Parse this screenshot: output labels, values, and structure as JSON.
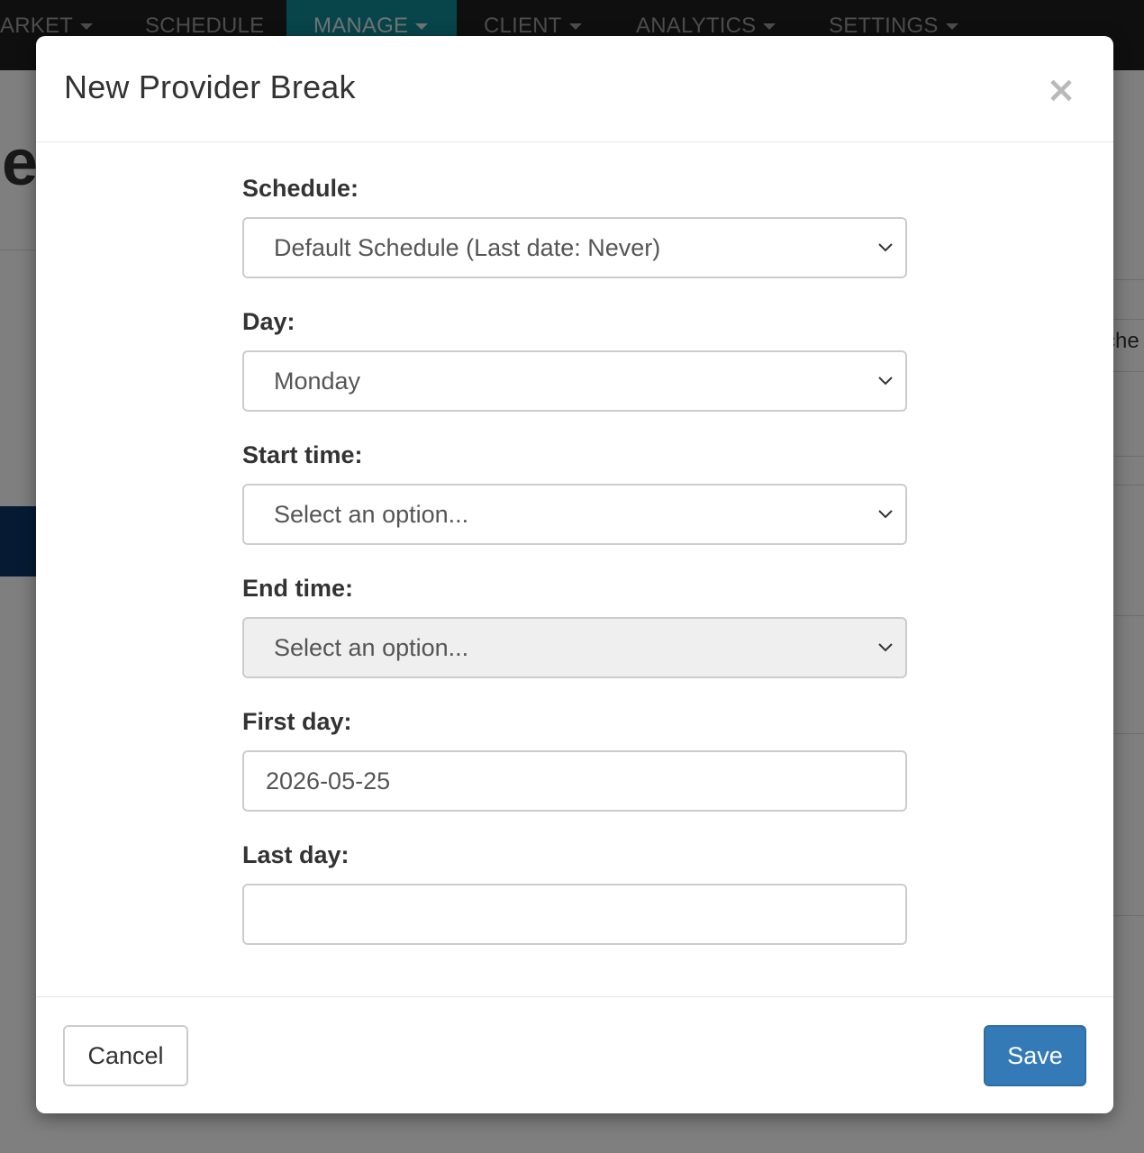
{
  "nav": {
    "items": [
      {
        "label": "ARKET"
      },
      {
        "label": "SCHEDULE"
      },
      {
        "label": "MANAGE"
      },
      {
        "label": "CLIENT"
      },
      {
        "label": "ANALYTICS"
      },
      {
        "label": "SETTINGS"
      }
    ],
    "active_color": "#0e8a96"
  },
  "background": {
    "heading_fragment": "le",
    "right_text_fragment": "che"
  },
  "modal": {
    "title": "New Provider Break",
    "close_symbol": "×",
    "fields": {
      "schedule": {
        "label": "Schedule:",
        "value": "Default Schedule (Last date: Never)"
      },
      "day": {
        "label": "Day:",
        "value": "Monday"
      },
      "start_time": {
        "label": "Start time:",
        "value": "Select an option..."
      },
      "end_time": {
        "label": "End time:",
        "value": "Select an option...",
        "disabled": true
      },
      "first_day": {
        "label": "First day:",
        "value": "2026-05-25"
      },
      "last_day": {
        "label": "Last day:",
        "value": ""
      }
    },
    "footer": {
      "cancel_label": "Cancel",
      "save_label": "Save"
    }
  },
  "colors": {
    "primary": "#337ab7",
    "nav_background": "#1e1e1e"
  }
}
